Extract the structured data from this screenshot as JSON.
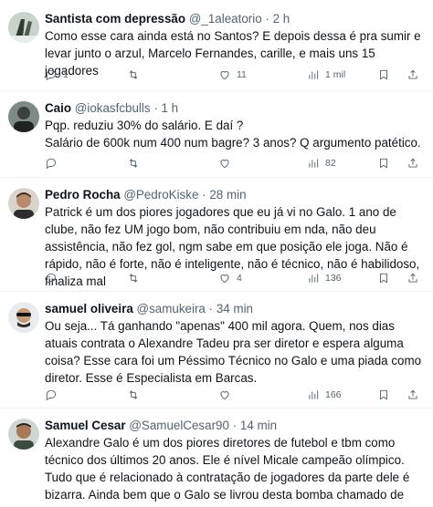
{
  "tweets": [
    {
      "name": "Santista com depressão",
      "handle": "@_1aleatorio",
      "sep": "·",
      "time": "2 h",
      "text": "Como esse cara ainda está no Santos? E depois dessa é pra sumir e levar junto o arzul, Marcelo Fernandes, carille, e mais uns 15 jogadores",
      "replies": "1",
      "retweets": "",
      "likes": "11",
      "views": "1 mil"
    },
    {
      "name": "Caio",
      "handle": "@iokasfcbulls",
      "sep": "·",
      "time": "1 h",
      "text": "Pqp. reduziu 30% do salário. E daí ?\nSalário de 600k num 400 num bagre? 3 anos? Q argumento patético.",
      "replies": "",
      "retweets": "",
      "likes": "",
      "views": "82"
    },
    {
      "name": "Pedro Rocha",
      "handle": "@PedroKiske",
      "sep": "·",
      "time": "28 min",
      "text": "Patrick é um dos piores jogadores que eu já vi no Galo. 1 ano de clube, não fez UM jogo bom, não contribuiu em nda, não deu assistência, não fez gol, ngm sabe em que posição ele joga. Não é rápido, não é forte, não é inteligente, não é técnico, não é habilidoso, finaliza mal",
      "replies": "",
      "retweets": "",
      "likes": "4",
      "views": "136"
    },
    {
      "name": "samuel oliveira",
      "handle": "@samukeira",
      "sep": "·",
      "time": "34 min",
      "text": "Ou seja... Tá ganhando \"apenas\" 400 mil agora. Quem, nos dias atuais contrata o Alexandre Tadeu pra ser diretor e espera alguma coisa? Esse cara foi um Péssimo Técnico no Galo e uma piada como diretor. Esse é Especialista em Barcas.",
      "replies": "",
      "retweets": "",
      "likes": "",
      "views": "166"
    },
    {
      "name": "Samuel Cesar",
      "handle": "@SamuelCesar90",
      "sep": "·",
      "time": "14 min",
      "text": "Alexandre Galo é um dos piores diretores de futebol e tbm como técnico dos últimos 20 anos. Ele é nível Micale campeão olímpico. Tudo que é relacionado à contratação de jogadores da parte dele é bizarra. Ainda bem que o Galo se livrou desta bomba chamado de Patrick.",
      "replies": "",
      "retweets": "",
      "likes": "",
      "views": ""
    }
  ],
  "colors": {
    "text": "#0f1419",
    "secondary": "#536471",
    "border": "#eff3f4"
  },
  "icons": [
    "reply-icon",
    "retweet-icon",
    "like-icon",
    "views-icon",
    "bookmark-icon",
    "share-icon"
  ]
}
